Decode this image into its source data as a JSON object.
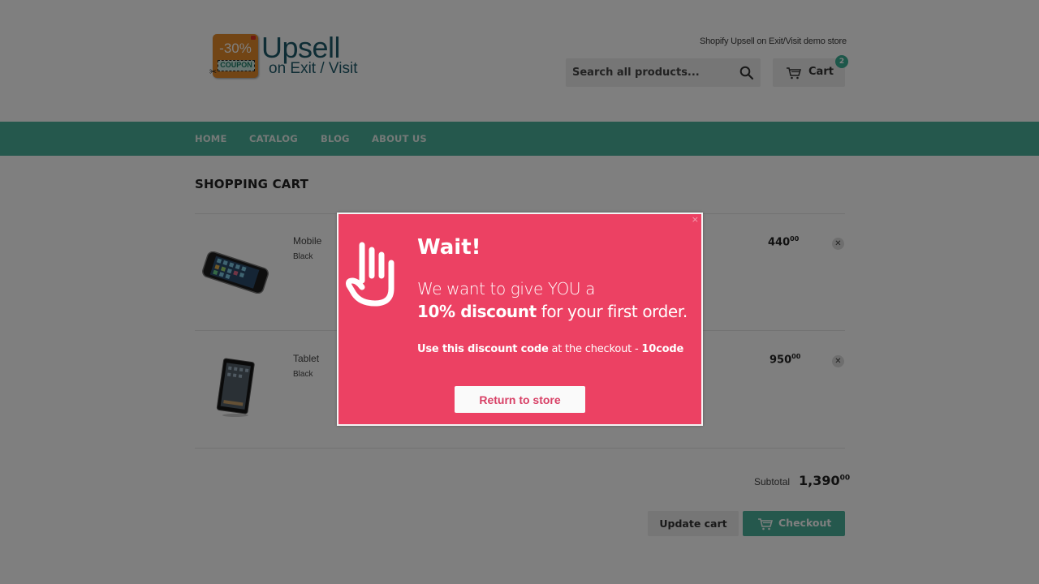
{
  "store": {
    "tagline": "Shopify Upsell on Exit/Visit demo store",
    "logo": {
      "badge_percent": "-30%",
      "badge_coupon": "COUPON",
      "title": "Upsell",
      "subtitle": "on Exit / Visit"
    }
  },
  "header": {
    "search_placeholder": "Search all products...",
    "search_icon": "search-icon",
    "cart_label": "Cart",
    "cart_icon": "cart-icon",
    "cart_count": "2"
  },
  "nav": {
    "items": [
      {
        "label": "HOME"
      },
      {
        "label": "CATALOG"
      },
      {
        "label": "BLOG"
      },
      {
        "label": "ABOUT US"
      }
    ]
  },
  "cart": {
    "title": "SHOPPING CART",
    "items": [
      {
        "name": "Mobile",
        "variant": "Black",
        "price": "440",
        "price_cents": "00",
        "remove_icon": "close-icon"
      },
      {
        "name": "Tablet",
        "variant": "Black",
        "price": "950",
        "price_cents": "00",
        "remove_icon": "close-icon"
      }
    ],
    "subtotal_label": "Subtotal",
    "subtotal_value": "1,390",
    "subtotal_cents": "00",
    "update_label": "Update cart",
    "checkout_label": "Checkout"
  },
  "popup": {
    "close_label": "×",
    "hand_icon": "hand-stop-icon",
    "heading": "Wait!",
    "line1": "We want to give YOU a",
    "line2_bold": "10% discount",
    "line2_rest": " for your first order.",
    "line3_bold": "Use this discount code",
    "line3_mid": " at the checkout - ",
    "line3_code": "10code",
    "button_label": "Return to store",
    "colors": {
      "background": "#ec4163",
      "button_text": "#d84066"
    }
  },
  "colors": {
    "brand_teal": "#4ab09a",
    "overlay": "rgba(0,0,0,0.5)"
  }
}
